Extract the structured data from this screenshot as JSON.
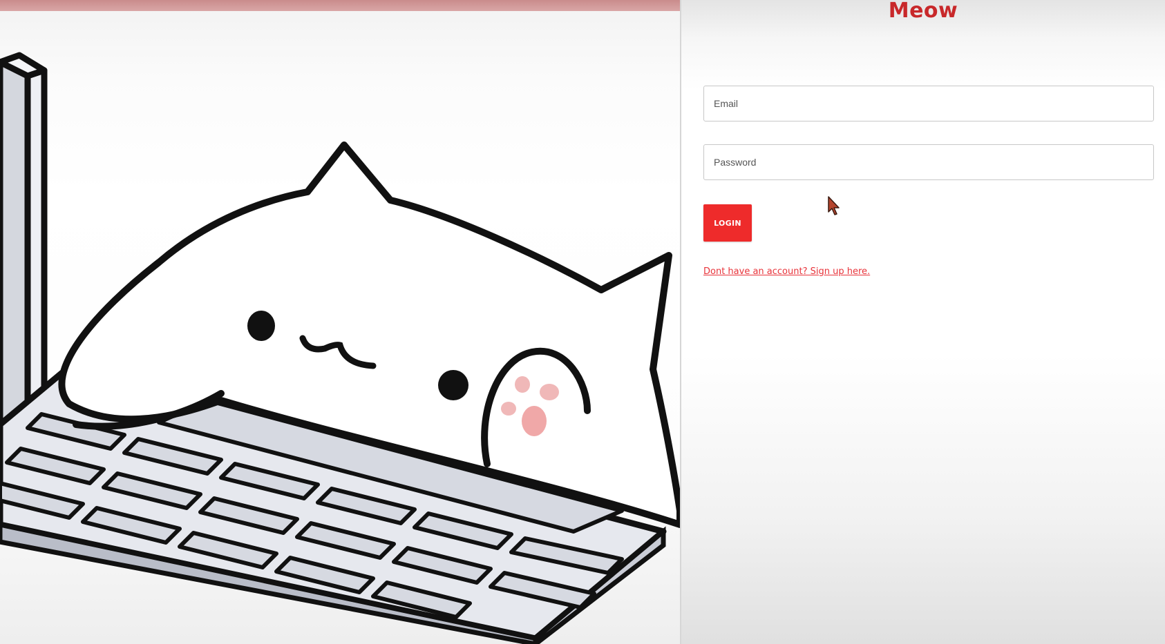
{
  "app": {
    "brand_title": "Meow"
  },
  "login_form": {
    "email_placeholder": "Email",
    "password_placeholder": "Password",
    "login_label": "LOGIN",
    "signup_link": "Dont have an account? Sign up here."
  },
  "colors": {
    "accent": "#ee2b2b",
    "brand": "#c8282a",
    "link": "#e8333a"
  },
  "icons": {
    "illustration": "cat-typing-illustration",
    "pointer": "mouse-pointer-icon"
  }
}
